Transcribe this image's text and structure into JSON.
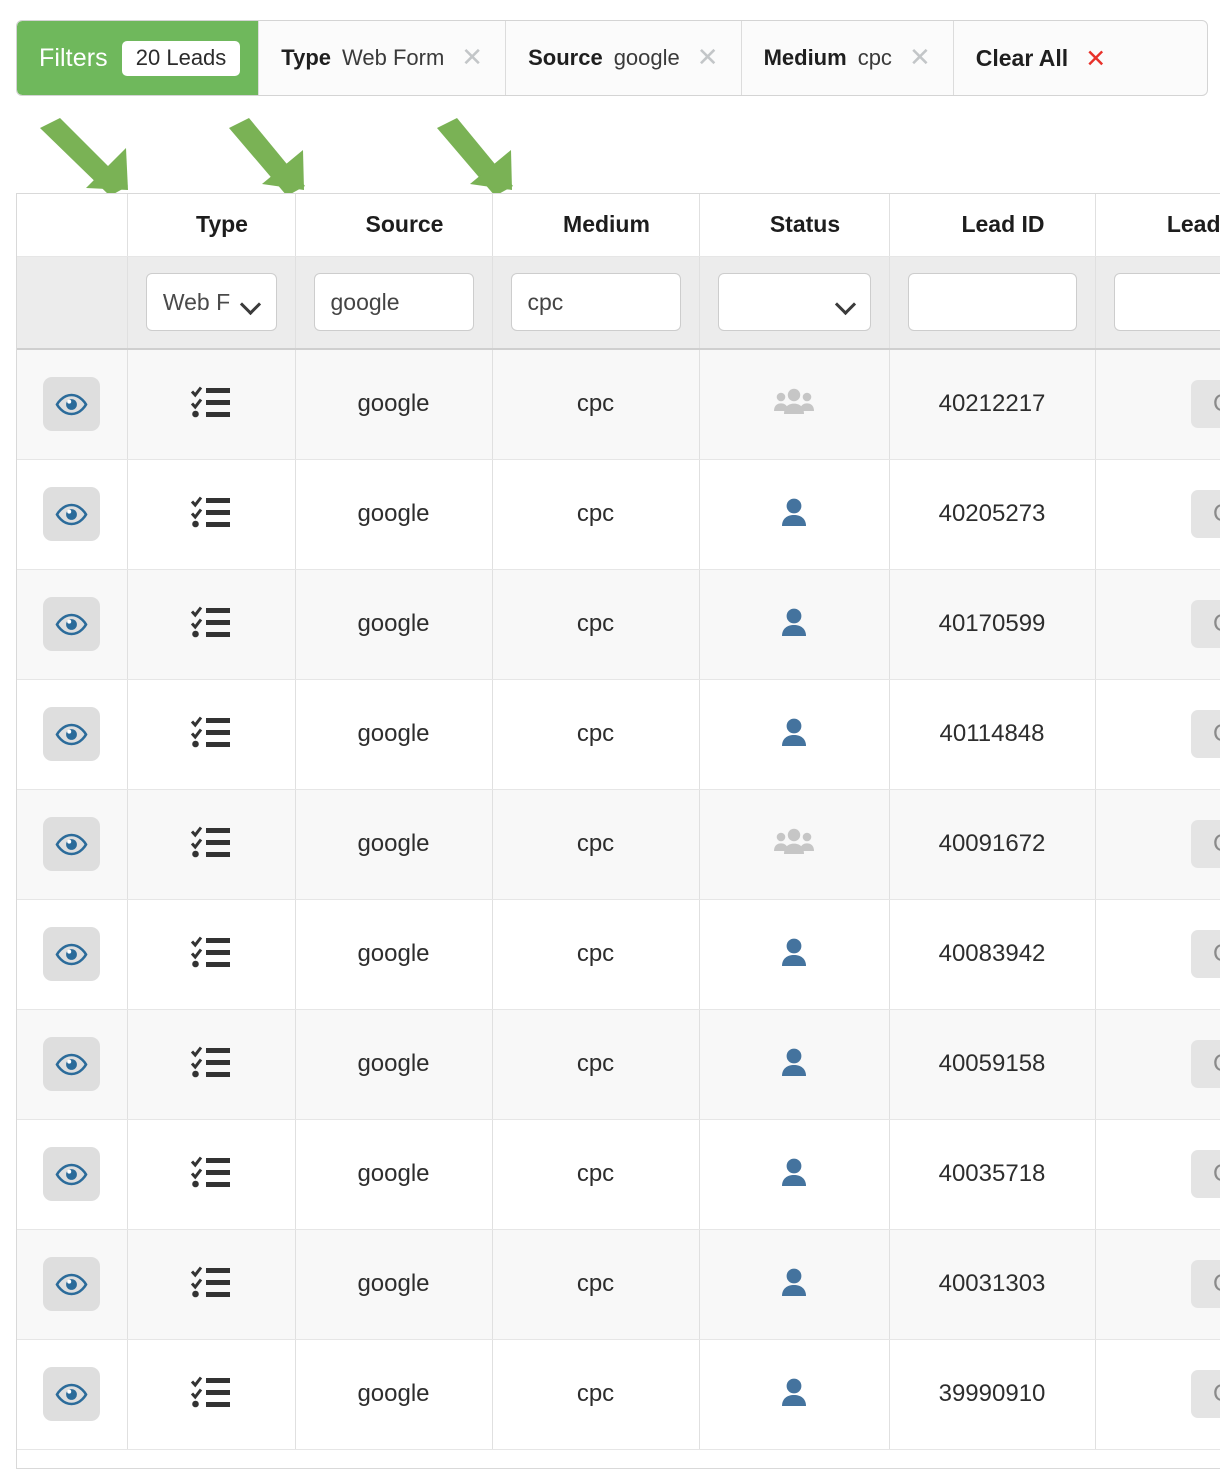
{
  "filter_bar": {
    "filters_label": "Filters",
    "lead_count": "20 Leads",
    "chips": [
      {
        "key": "Type",
        "value": "Web Form",
        "remove_icon": "close-icon"
      },
      {
        "key": "Source",
        "value": "google",
        "remove_icon": "close-icon"
      },
      {
        "key": "Medium",
        "value": "cpc",
        "remove_icon": "close-icon"
      }
    ],
    "clear_all": {
      "label": "Clear All",
      "remove_icon": "close-icon"
    }
  },
  "annotations": {
    "arrow_color": "#7ab255",
    "arrows": [
      {
        "name": "arrow-to-type-column"
      },
      {
        "name": "arrow-to-source-column"
      },
      {
        "name": "arrow-to-medium-column"
      }
    ]
  },
  "table": {
    "columns": [
      "",
      "Type",
      "Source",
      "Medium",
      "Status",
      "Lead ID",
      "Lead Status"
    ],
    "filter_row": {
      "type_select_value": "Web F",
      "source_input_value": "google",
      "medium_input_value": "cpc",
      "status_select_value": "",
      "lead_id_input_value": "",
      "lead_status_input_value": ""
    },
    "rows": [
      {
        "eye": "eye-icon",
        "type_icon": "tasklist-icon",
        "source": "google",
        "medium": "cpc",
        "status_icon": "users-group-icon",
        "lead_id": "40212217",
        "lead_status": "Comp"
      },
      {
        "eye": "eye-icon",
        "type_icon": "tasklist-icon",
        "source": "google",
        "medium": "cpc",
        "status_icon": "user-icon",
        "lead_id": "40205273",
        "lead_status": "Comp"
      },
      {
        "eye": "eye-icon",
        "type_icon": "tasklist-icon",
        "source": "google",
        "medium": "cpc",
        "status_icon": "user-icon",
        "lead_id": "40170599",
        "lead_status": "Comp"
      },
      {
        "eye": "eye-icon",
        "type_icon": "tasklist-icon",
        "source": "google",
        "medium": "cpc",
        "status_icon": "user-icon",
        "lead_id": "40114848",
        "lead_status": "Comp"
      },
      {
        "eye": "eye-icon",
        "type_icon": "tasklist-icon",
        "source": "google",
        "medium": "cpc",
        "status_icon": "users-group-icon",
        "lead_id": "40091672",
        "lead_status": "Comp"
      },
      {
        "eye": "eye-icon",
        "type_icon": "tasklist-icon",
        "source": "google",
        "medium": "cpc",
        "status_icon": "user-icon",
        "lead_id": "40083942",
        "lead_status": "Comp"
      },
      {
        "eye": "eye-icon",
        "type_icon": "tasklist-icon",
        "source": "google",
        "medium": "cpc",
        "status_icon": "user-icon",
        "lead_id": "40059158",
        "lead_status": "Comp"
      },
      {
        "eye": "eye-icon",
        "type_icon": "tasklist-icon",
        "source": "google",
        "medium": "cpc",
        "status_icon": "user-icon",
        "lead_id": "40035718",
        "lead_status": "Comp"
      },
      {
        "eye": "eye-icon",
        "type_icon": "tasklist-icon",
        "source": "google",
        "medium": "cpc",
        "status_icon": "user-icon",
        "lead_id": "40031303",
        "lead_status": "Comp"
      },
      {
        "eye": "eye-icon",
        "type_icon": "tasklist-icon",
        "source": "google",
        "medium": "cpc",
        "status_icon": "user-icon",
        "lead_id": "39990910",
        "lead_status": "Comp"
      }
    ]
  },
  "colors": {
    "filters_green": "#6fb85c",
    "arrow_green": "#7ab255",
    "eye_blue": "#2b6b9a",
    "status_user_blue": "#44739e",
    "status_group_gray": "#c6c6c6",
    "clear_red": "#e8312a",
    "badge_bg": "#e4e4e4"
  }
}
